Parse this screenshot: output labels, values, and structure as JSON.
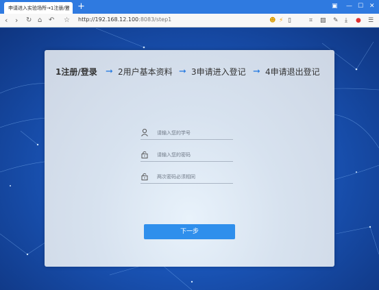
{
  "browser": {
    "tab_title": "申请进入实验场所→1注册/登",
    "tab_close": "×",
    "new_tab": "+",
    "address": {
      "host": "http://192.168.12.100",
      "port_path": ":8083/step1"
    }
  },
  "steps": [
    {
      "label": "1注册/登录"
    },
    {
      "label": "2用户基本资料"
    },
    {
      "label": "3申请进入登记"
    },
    {
      "label": "4申请退出登记"
    }
  ],
  "step_arrow": "➞",
  "form": {
    "student_id_placeholder": "请输入您的学号",
    "password_placeholder": "请输入您的密码",
    "confirm_placeholder": "两次密码必须相同",
    "next_label": "下一步"
  },
  "colors": {
    "chrome_blue": "#2f7ae0",
    "accent": "#2a7de1",
    "button": "#2f8fec"
  }
}
